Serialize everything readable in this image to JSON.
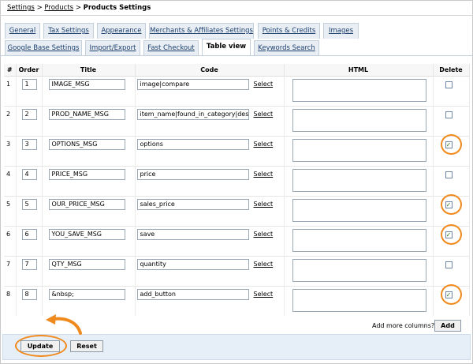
{
  "breadcrumb": {
    "settings": "Settings",
    "products": "Products",
    "separator": ">",
    "current": "Products Settings"
  },
  "tabs": {
    "row1": [
      "General",
      "Tax Settings",
      "Appearance",
      "Merchants & Affiliates Settings",
      "Points & Credits",
      "Images"
    ],
    "row2": [
      "Google Base Settings",
      "Import/Export",
      "Fast Checkout",
      "Table view",
      "Keywords Search"
    ],
    "active": "Table view"
  },
  "table": {
    "headers": {
      "num": "#",
      "order": "Order",
      "title": "Title",
      "code": "Code",
      "html": "HTML",
      "delete": "Delete"
    },
    "select_label": "Select",
    "rows": [
      {
        "num": "1",
        "order": "1",
        "title": "IMAGE_MSG",
        "code": "image|compare",
        "html": "",
        "delete": false
      },
      {
        "num": "2",
        "order": "2",
        "title": "PROD_NAME_MSG",
        "code": "item_name|found_in_category|descripti",
        "html": "",
        "delete": false
      },
      {
        "num": "3",
        "order": "3",
        "title": "OPTIONS_MSG",
        "code": "options",
        "html": "",
        "delete": true
      },
      {
        "num": "4",
        "order": "4",
        "title": "PRICE_MSG",
        "code": "price",
        "html": "",
        "delete": false
      },
      {
        "num": "5",
        "order": "5",
        "title": "OUR_PRICE_MSG",
        "code": "sales_price",
        "html": "",
        "delete": true
      },
      {
        "num": "6",
        "order": "6",
        "title": "YOU_SAVE_MSG",
        "code": "save",
        "html": "",
        "delete": true
      },
      {
        "num": "7",
        "order": "7",
        "title": "QTY_MSG",
        "code": "quantity",
        "html": "",
        "delete": false
      },
      {
        "num": "8",
        "order": "8",
        "title": "&nbsp;",
        "code": "add_button",
        "html": "",
        "delete": true
      }
    ]
  },
  "add_columns": {
    "label": "Add more columns?",
    "button": "Add"
  },
  "footer": {
    "update": "Update",
    "reset": "Reset"
  },
  "colors": {
    "highlight": "#f08a1c",
    "tab_bg": "#e8eef4",
    "footer_bg": "#e6eef7",
    "check": "#2c7a1d"
  }
}
